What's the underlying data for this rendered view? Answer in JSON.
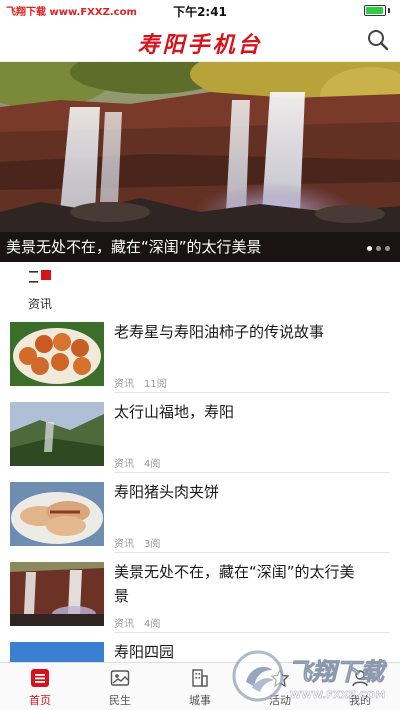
{
  "status_bar": {
    "left_text": "飞翔下载 www.FXXZ.com",
    "time": "下午2:41",
    "battery_level": 0.92
  },
  "header": {
    "title": "寿阳手机台",
    "search_icon": "search-icon"
  },
  "banner": {
    "caption": "美景无处不在，藏在“深闺”的太行美景",
    "slide_count": 3,
    "active_slide": 1
  },
  "category_tab": {
    "label": "资讯",
    "icon": "category-menu-icon"
  },
  "news": [
    {
      "title": "老寿星与寿阳油柿子的传说故事",
      "category": "资讯",
      "views": "11阅"
    },
    {
      "title": "太行山福地，寿阳",
      "category": "资讯",
      "views": "4阅"
    },
    {
      "title": "寿阳猪头肉夹饼",
      "category": "资讯",
      "views": "3阅"
    },
    {
      "title": "美景无处不在，藏在“深闺”的太行美景",
      "category": "资讯",
      "views": "4阅"
    },
    {
      "title": "寿阳四园",
      "category": "",
      "views": ""
    }
  ],
  "bottom_nav": {
    "items": [
      {
        "label": "首页",
        "icon": "home-icon",
        "active": true
      },
      {
        "label": "民生",
        "icon": "image-icon",
        "active": false
      },
      {
        "label": "城事",
        "icon": "building-icon",
        "active": false
      },
      {
        "label": "活动",
        "icon": "activity-icon",
        "active": false
      },
      {
        "label": "我的",
        "icon": "user-icon",
        "active": false
      }
    ]
  },
  "watermark": {
    "brand": "飞翔下载",
    "url": "WWW.FXXZ.COM"
  },
  "colors": {
    "brand_red": "#d8121a",
    "meta_gray": "#999999"
  }
}
